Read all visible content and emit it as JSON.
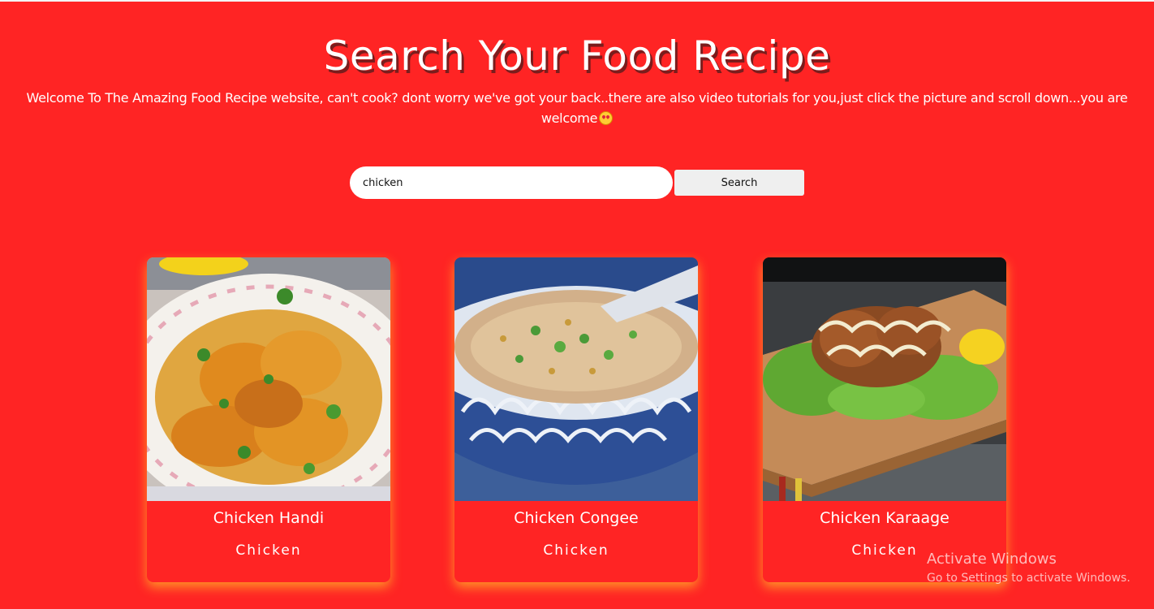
{
  "header": {
    "title": "Search Your Food Recipe",
    "subtitle": "Welcome To The Amazing Food Recipe website, can't cook? dont worry we've got your back..there are also video tutorials for you,just click the picture and scroll down...you are welcome",
    "emoji_icon": "heart-eyes-emoji-icon"
  },
  "search": {
    "value": "chicken",
    "button_label": "Search"
  },
  "recipes": [
    {
      "name": "Chicken Handi",
      "category": "Chicken"
    },
    {
      "name": "Chicken Congee",
      "category": "Chicken"
    },
    {
      "name": "Chicken Karaage",
      "category": "Chicken"
    }
  ],
  "watermark": {
    "title": "Activate Windows",
    "subtitle": "Go to Settings to activate Windows."
  },
  "colors": {
    "background": "#ff2424",
    "card_glow": "#ffaa28",
    "button": "#efefef"
  }
}
